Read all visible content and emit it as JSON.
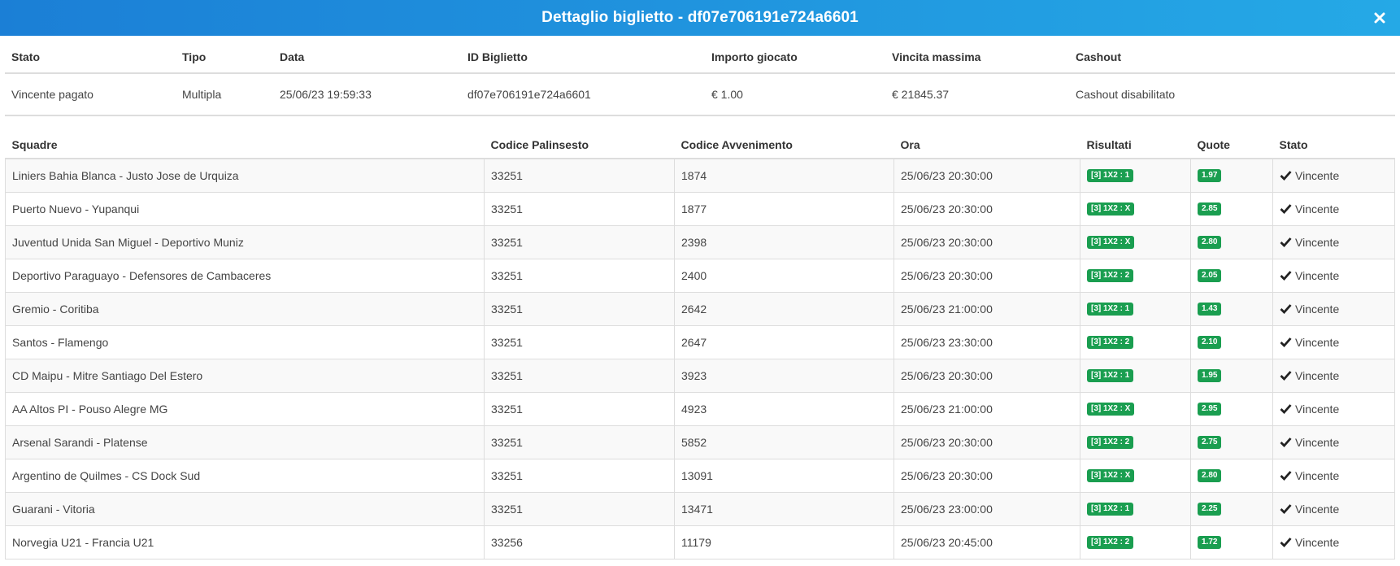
{
  "modal": {
    "title": "Dettaglio biglietto - df07e706191e724a6601",
    "close_icon": "close-icon"
  },
  "summary": {
    "headers": [
      "Stato",
      "Tipo",
      "Data",
      "ID Biglietto",
      "Importo giocato",
      "Vincita massima",
      "Cashout"
    ],
    "row": [
      "Vincente pagato",
      "Multipla",
      "25/06/23 19:59:33",
      "df07e706191e724a6601",
      "€ 1.00",
      "€ 21845.37",
      "Cashout disabilitato"
    ]
  },
  "events": {
    "headers": [
      "Squadre",
      "Codice Palinsesto",
      "Codice Avvenimento",
      "Ora",
      "Risultati",
      "Quote",
      "Stato"
    ],
    "rows": [
      {
        "teams": "Liniers Bahia Blanca - Justo Jose de Urquiza",
        "palinsesto": "33251",
        "avvenimento": "1874",
        "ora": "25/06/23 20:30:00",
        "risultato": "[3] 1X2 : 1",
        "quota": "1.97",
        "stato": "Vincente"
      },
      {
        "teams": "Puerto Nuevo - Yupanqui",
        "palinsesto": "33251",
        "avvenimento": "1877",
        "ora": "25/06/23 20:30:00",
        "risultato": "[3] 1X2 : X",
        "quota": "2.85",
        "stato": "Vincente"
      },
      {
        "teams": "Juventud Unida San Miguel - Deportivo Muniz",
        "palinsesto": "33251",
        "avvenimento": "2398",
        "ora": "25/06/23 20:30:00",
        "risultato": "[3] 1X2 : X",
        "quota": "2.80",
        "stato": "Vincente"
      },
      {
        "teams": "Deportivo Paraguayo - Defensores de Cambaceres",
        "palinsesto": "33251",
        "avvenimento": "2400",
        "ora": "25/06/23 20:30:00",
        "risultato": "[3] 1X2 : 2",
        "quota": "2.05",
        "stato": "Vincente"
      },
      {
        "teams": "Gremio - Coritiba",
        "palinsesto": "33251",
        "avvenimento": "2642",
        "ora": "25/06/23 21:00:00",
        "risultato": "[3] 1X2 : 1",
        "quota": "1.43",
        "stato": "Vincente"
      },
      {
        "teams": "Santos - Flamengo",
        "palinsesto": "33251",
        "avvenimento": "2647",
        "ora": "25/06/23 23:30:00",
        "risultato": "[3] 1X2 : 2",
        "quota": "2.10",
        "stato": "Vincente"
      },
      {
        "teams": "CD Maipu - Mitre Santiago Del Estero",
        "palinsesto": "33251",
        "avvenimento": "3923",
        "ora": "25/06/23 20:30:00",
        "risultato": "[3] 1X2 : 1",
        "quota": "1.95",
        "stato": "Vincente"
      },
      {
        "teams": "AA Altos PI - Pouso Alegre MG",
        "palinsesto": "33251",
        "avvenimento": "4923",
        "ora": "25/06/23 21:00:00",
        "risultato": "[3] 1X2 : X",
        "quota": "2.95",
        "stato": "Vincente"
      },
      {
        "teams": "Arsenal Sarandi - Platense",
        "palinsesto": "33251",
        "avvenimento": "5852",
        "ora": "25/06/23 20:30:00",
        "risultato": "[3] 1X2 : 2",
        "quota": "2.75",
        "stato": "Vincente"
      },
      {
        "teams": "Argentino de Quilmes - CS Dock Sud",
        "palinsesto": "33251",
        "avvenimento": "13091",
        "ora": "25/06/23 20:30:00",
        "risultato": "[3] 1X2 : X",
        "quota": "2.80",
        "stato": "Vincente"
      },
      {
        "teams": "Guarani - Vitoria",
        "palinsesto": "33251",
        "avvenimento": "13471",
        "ora": "25/06/23 23:00:00",
        "risultato": "[3] 1X2 : 1",
        "quota": "2.25",
        "stato": "Vincente"
      },
      {
        "teams": "Norvegia U21 - Francia U21",
        "palinsesto": "33256",
        "avvenimento": "11179",
        "ora": "25/06/23 20:45:00",
        "risultato": "[3] 1X2 : 2",
        "quota": "1.72",
        "stato": "Vincente"
      }
    ]
  },
  "colors": {
    "header_start": "#1b7fd6",
    "header_end": "#25a9e6",
    "label_green": "#1a9e50"
  },
  "icons": {
    "status": "check-icon"
  }
}
